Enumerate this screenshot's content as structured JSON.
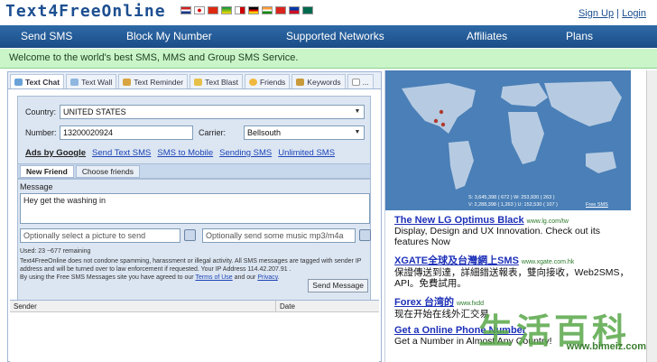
{
  "header": {
    "logo": "Text4FreeOnline",
    "signup": "Sign Up",
    "separator": "|",
    "login": "Login",
    "flags": [
      "#c22",
      "#fff",
      "#d00",
      "#de2910",
      "#00923f",
      "#cc0000",
      "#000000",
      "#ff9933",
      "#da251d",
      "#0038a8",
      "#006a4e"
    ]
  },
  "nav": {
    "items": [
      "Send SMS",
      "Block My Number",
      "Supported Networks",
      "Affiliates",
      "Plans"
    ]
  },
  "welcome": "Welcome to the world's best SMS, MMS and Group SMS Service.",
  "tabs": [
    "Text Chat",
    "Text Wall",
    "Text Reminder",
    "Text Blast",
    "Friends",
    "Keywords",
    "..."
  ],
  "form": {
    "country_label": "Country:",
    "country_value": "UNITED STATES",
    "number_label": "Number:",
    "number_value": "13200020924",
    "carrier_label": "Carrier:",
    "carrier_value": "Bellsouth",
    "links": [
      "Ads by Google",
      "Send Text SMS",
      "SMS to Mobile",
      "Sending SMS",
      "Unlimited SMS"
    ],
    "subtabs": [
      "New Friend",
      "Choose friends"
    ]
  },
  "message": {
    "label": "Message",
    "value": "Hey get the washing in",
    "picture_placeholder": "Optionally select a picture to send",
    "music_placeholder": "Optionally send some music mp3/m4a",
    "used": "Used: 23 ~677 remaining",
    "disclaimer1": "Text4FreeOnline does not condone spamming, harassment or illegal activity. All SMS messages are tagged with sender IP",
    "disclaimer2": "address and will be turned over to law enforcement if requested. Your IP Address 114.42.207.91 .",
    "disclaimer3_pre": "By using the Free SMS Messages site you have agreed to our",
    "terms": "Terms of Use",
    "and_our": "and our",
    "privacy": "Privacy",
    "send_button": "Send Message"
  },
  "grid": {
    "col_sender": "Sender",
    "col_date": "Date"
  },
  "map": {
    "stats1": "S: 3,645,398 ( 672 ) W: 253,930 ( 263 )",
    "stats2": "V: 2,288,398 ( 1,263 ) U: 152,530 ( 107 )",
    "free_sms": "Free SMS"
  },
  "ads": [
    {
      "title": "The New LG Optimus Black",
      "url": "www.lg.com/tw",
      "body": "Display, Design and UX Innovation. Check out its features Now"
    },
    {
      "title": "XGATE全球及台灣網上SMS",
      "url": "www.xgate.com.hk",
      "body": "保證傳送到達，詳細錯送報表，雙向接收，Web2SMS，API。免費試用。"
    },
    {
      "title": "Forex 台湾的",
      "url": "www.fxdd",
      "body": "现在开始在线外汇交易"
    },
    {
      "title": "Get a Online Phone Number",
      "url": "",
      "body": "Get a Number in Almost Any Country!"
    }
  ],
  "watermark": {
    "chars": "生活百科",
    "url": "www.bimeiz.com"
  }
}
